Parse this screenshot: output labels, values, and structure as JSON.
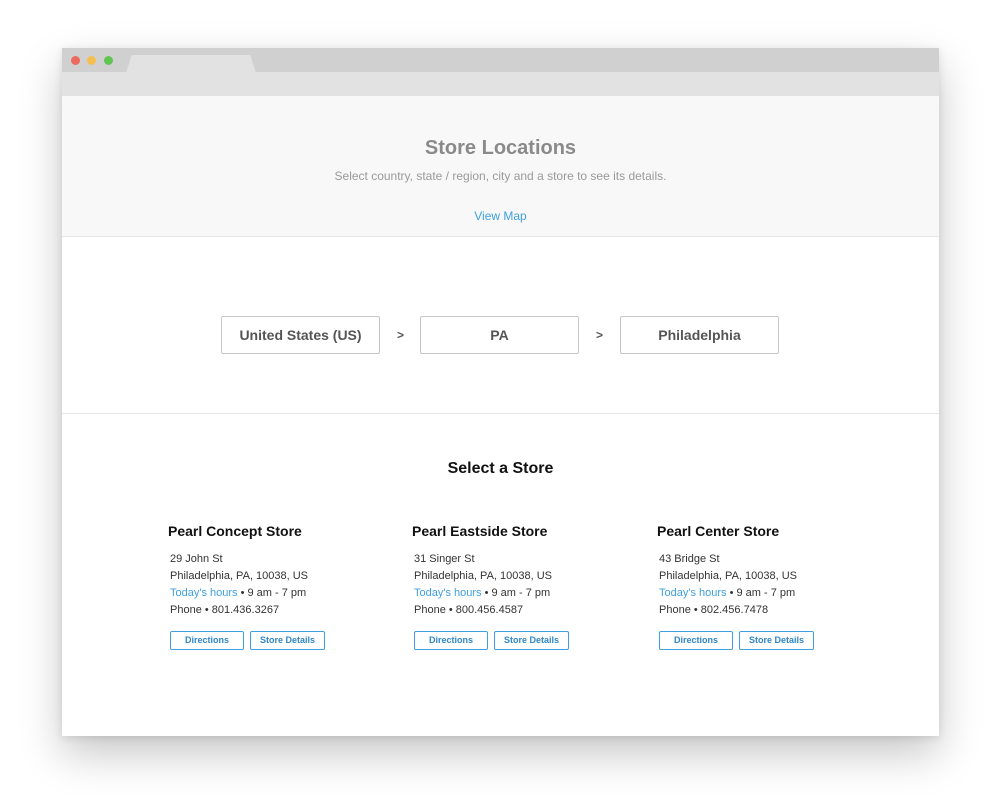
{
  "header": {
    "title": "Store Locations",
    "subtitle": "Select country, state / region, city and a store to see its details.",
    "view_map": "View Map"
  },
  "selectors": {
    "country": "United States (US)",
    "state": "PA",
    "city": "Philadelphia",
    "separator": ">"
  },
  "stores_section": {
    "title": "Select a Store"
  },
  "stores": [
    {
      "name": "Pearl Concept Store",
      "street": "29 John St",
      "city_line": "Philadelphia, PA, 10038, US",
      "hours_label": "Today's hours",
      "hours": " • 9 am - 7 pm",
      "phone": "Phone • 801.436.3267",
      "directions": "Directions",
      "details": "Store Details"
    },
    {
      "name": "Pearl Eastside Store",
      "street": "31 Singer St",
      "city_line": "Philadelphia, PA, 10038, US",
      "hours_label": "Today's hours",
      "hours": " • 9 am - 7 pm",
      "phone": "Phone • 800.456.4587",
      "directions": "Directions",
      "details": "Store Details"
    },
    {
      "name": "Pearl Center Store",
      "street": "43 Bridge St",
      "city_line": "Philadelphia, PA, 10038, US",
      "hours_label": "Today's hours",
      "hours": " • 9 am - 7 pm",
      "phone": "Phone • 802.456.7478",
      "directions": "Directions",
      "details": "Store Details"
    }
  ],
  "colors": {
    "accent": "#3f9fe0",
    "title_gray": "#8a8a8a",
    "traffic_red": "#ec6a5e",
    "traffic_yellow": "#f4bf4f",
    "traffic_green": "#61c554"
  }
}
